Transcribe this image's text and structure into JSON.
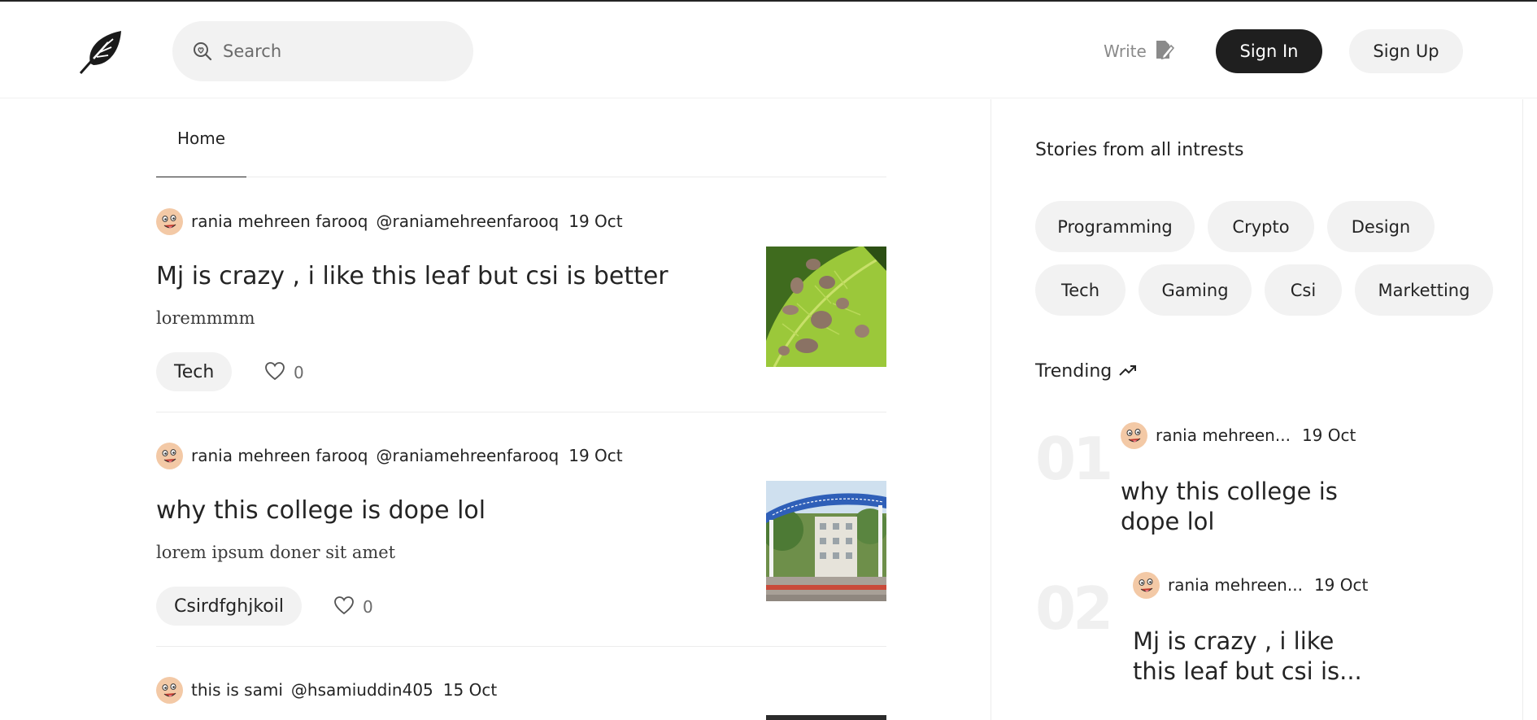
{
  "header": {
    "search_placeholder": "Search",
    "write_label": "Write",
    "signin_label": "Sign In",
    "signup_label": "Sign Up"
  },
  "tabs": [
    {
      "label": "Home"
    }
  ],
  "posts": [
    {
      "author": "rania mehreen farooq",
      "handle": "@raniamehreenfarooq",
      "date": "19 Oct",
      "title": "Mj is crazy , i like this leaf but csi is better",
      "excerpt": "loremmmm",
      "tag": "Tech",
      "likes": "0"
    },
    {
      "author": "rania mehreen farooq",
      "handle": "@raniamehreenfarooq",
      "date": "19 Oct",
      "title": "why this college is dope lol",
      "excerpt": "lorem ipsum doner sit amet",
      "tag": "Csirdfghjkoil",
      "likes": "0"
    },
    {
      "author": "this is sami",
      "handle": "@hsamiuddin405",
      "date": "15 Oct"
    }
  ],
  "sidebar": {
    "interests_title": "Stories from all intrests",
    "topics": [
      "Programming",
      "Crypto",
      "Design",
      "Tech",
      "Gaming",
      "Csi",
      "Marketting"
    ],
    "trending_title": "Trending",
    "trending": [
      {
        "rank": "01",
        "author": "rania mehreen...",
        "date": "19 Oct",
        "title": "why this college is dope lol"
      },
      {
        "rank": "02",
        "author": "rania mehreen...",
        "date": "19 Oct",
        "title": "Mj is crazy , i like this leaf but csi is..."
      }
    ]
  }
}
